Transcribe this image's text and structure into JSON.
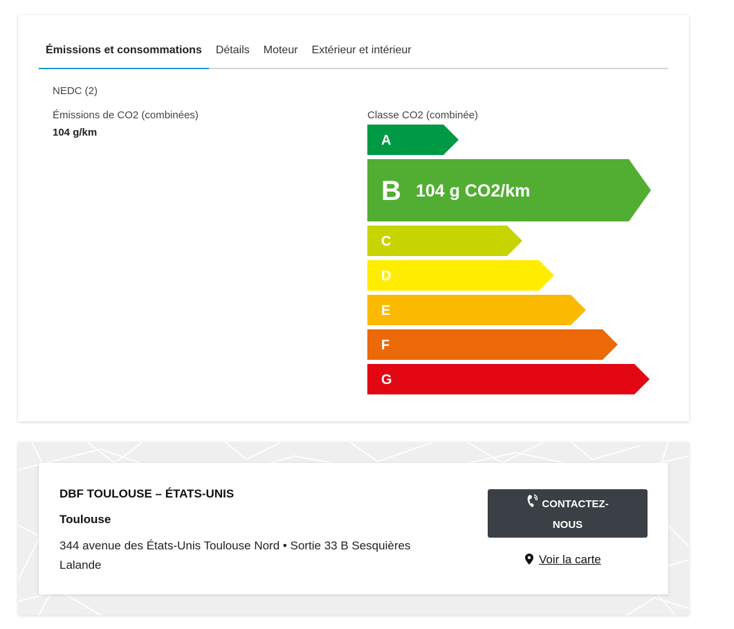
{
  "tabs": [
    {
      "label": "Émissions et consommations",
      "active": true
    },
    {
      "label": "Détails"
    },
    {
      "label": "Moteur"
    },
    {
      "label": "Extérieur et intérieur"
    }
  ],
  "emissions": {
    "norm": "NEDC (2)",
    "co2_label": "Émissions de CO2 (combinées)",
    "co2_value": "104 g/km",
    "class_label": "Classe CO2 (combinée)",
    "current_class": "B",
    "current_value_text": "104 g CO2/km",
    "classes": [
      {
        "letter": "A",
        "color": "#009a44"
      },
      {
        "letter": "B",
        "color": "#52ae32"
      },
      {
        "letter": "C",
        "color": "#c8d400"
      },
      {
        "letter": "D",
        "color": "#ffed00"
      },
      {
        "letter": "E",
        "color": "#fbba00"
      },
      {
        "letter": "F",
        "color": "#eb6909"
      },
      {
        "letter": "G",
        "color": "#e30613"
      }
    ]
  },
  "dealer": {
    "name": "DBF TOULOUSE – ÉTATS-UNIS",
    "city": "Toulouse",
    "address": "344 avenue des États-Unis Toulouse Nord • Sortie 33 B Sesquières Lalande",
    "contact_label_1": "CONTACTEZ-",
    "contact_label_2": "NOUS",
    "map_link": "Voir la carte"
  },
  "icons": {
    "phone": "phone-icon",
    "pin": "map-pin-icon"
  }
}
